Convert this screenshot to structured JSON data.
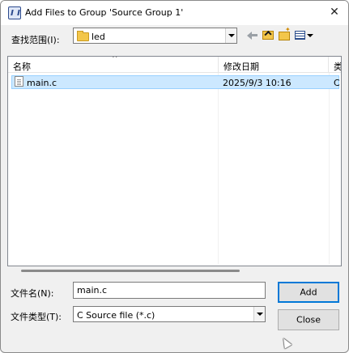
{
  "window": {
    "title": "Add Files to Group 'Source Group 1'"
  },
  "lookin": {
    "label": "查找范围(I):",
    "value": "led"
  },
  "columns": [
    "名称",
    "修改日期",
    "类型"
  ],
  "files": [
    {
      "name": "main.c",
      "modified": "2025/9/3 10:16",
      "type": "C :"
    }
  ],
  "filename": {
    "label": "文件名(N):",
    "value": "main.c"
  },
  "filetype": {
    "label": "文件类型(T):",
    "value": "C Source file (*.c)"
  },
  "buttons": {
    "add": "Add",
    "close": "Close"
  },
  "icons": {
    "app": "app-icon",
    "close": "close-icon",
    "folder": "folder-icon",
    "back": "back-arrow-icon",
    "up": "up-folder-icon",
    "new_folder": "new-folder-icon",
    "view": "view-menu-icon",
    "file": "c-file-icon"
  },
  "colors": {
    "selection": "#cce8ff",
    "selection_border": "#99d1ff",
    "default_button_border": "#0078d7"
  }
}
